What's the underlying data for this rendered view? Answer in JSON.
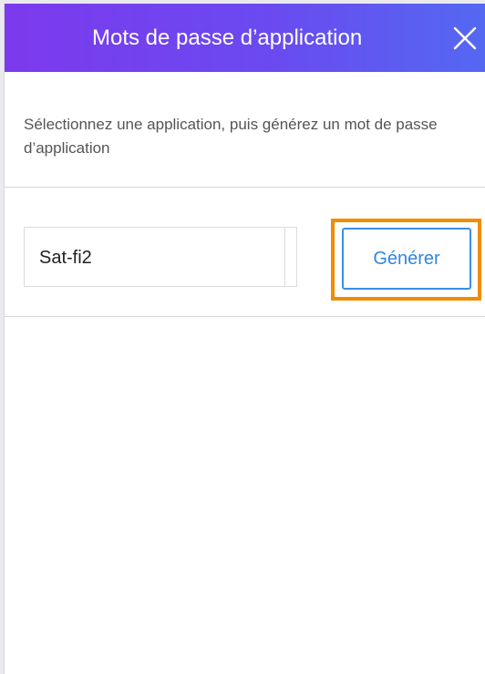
{
  "dialog": {
    "title": "Mots de passe d’application",
    "close_icon": "close-icon"
  },
  "description": "Sélectionnez une application, puis générez un mot de passe d’application",
  "app_selector": {
    "selected_value": "Sat-fi2"
  },
  "actions": {
    "generate_label": "Générer"
  },
  "colors": {
    "header_gradient_start": "#7c3aed",
    "header_gradient_end": "#5468f2",
    "button_accent": "#3a8ee6",
    "focus_highlight": "#f08c00"
  }
}
